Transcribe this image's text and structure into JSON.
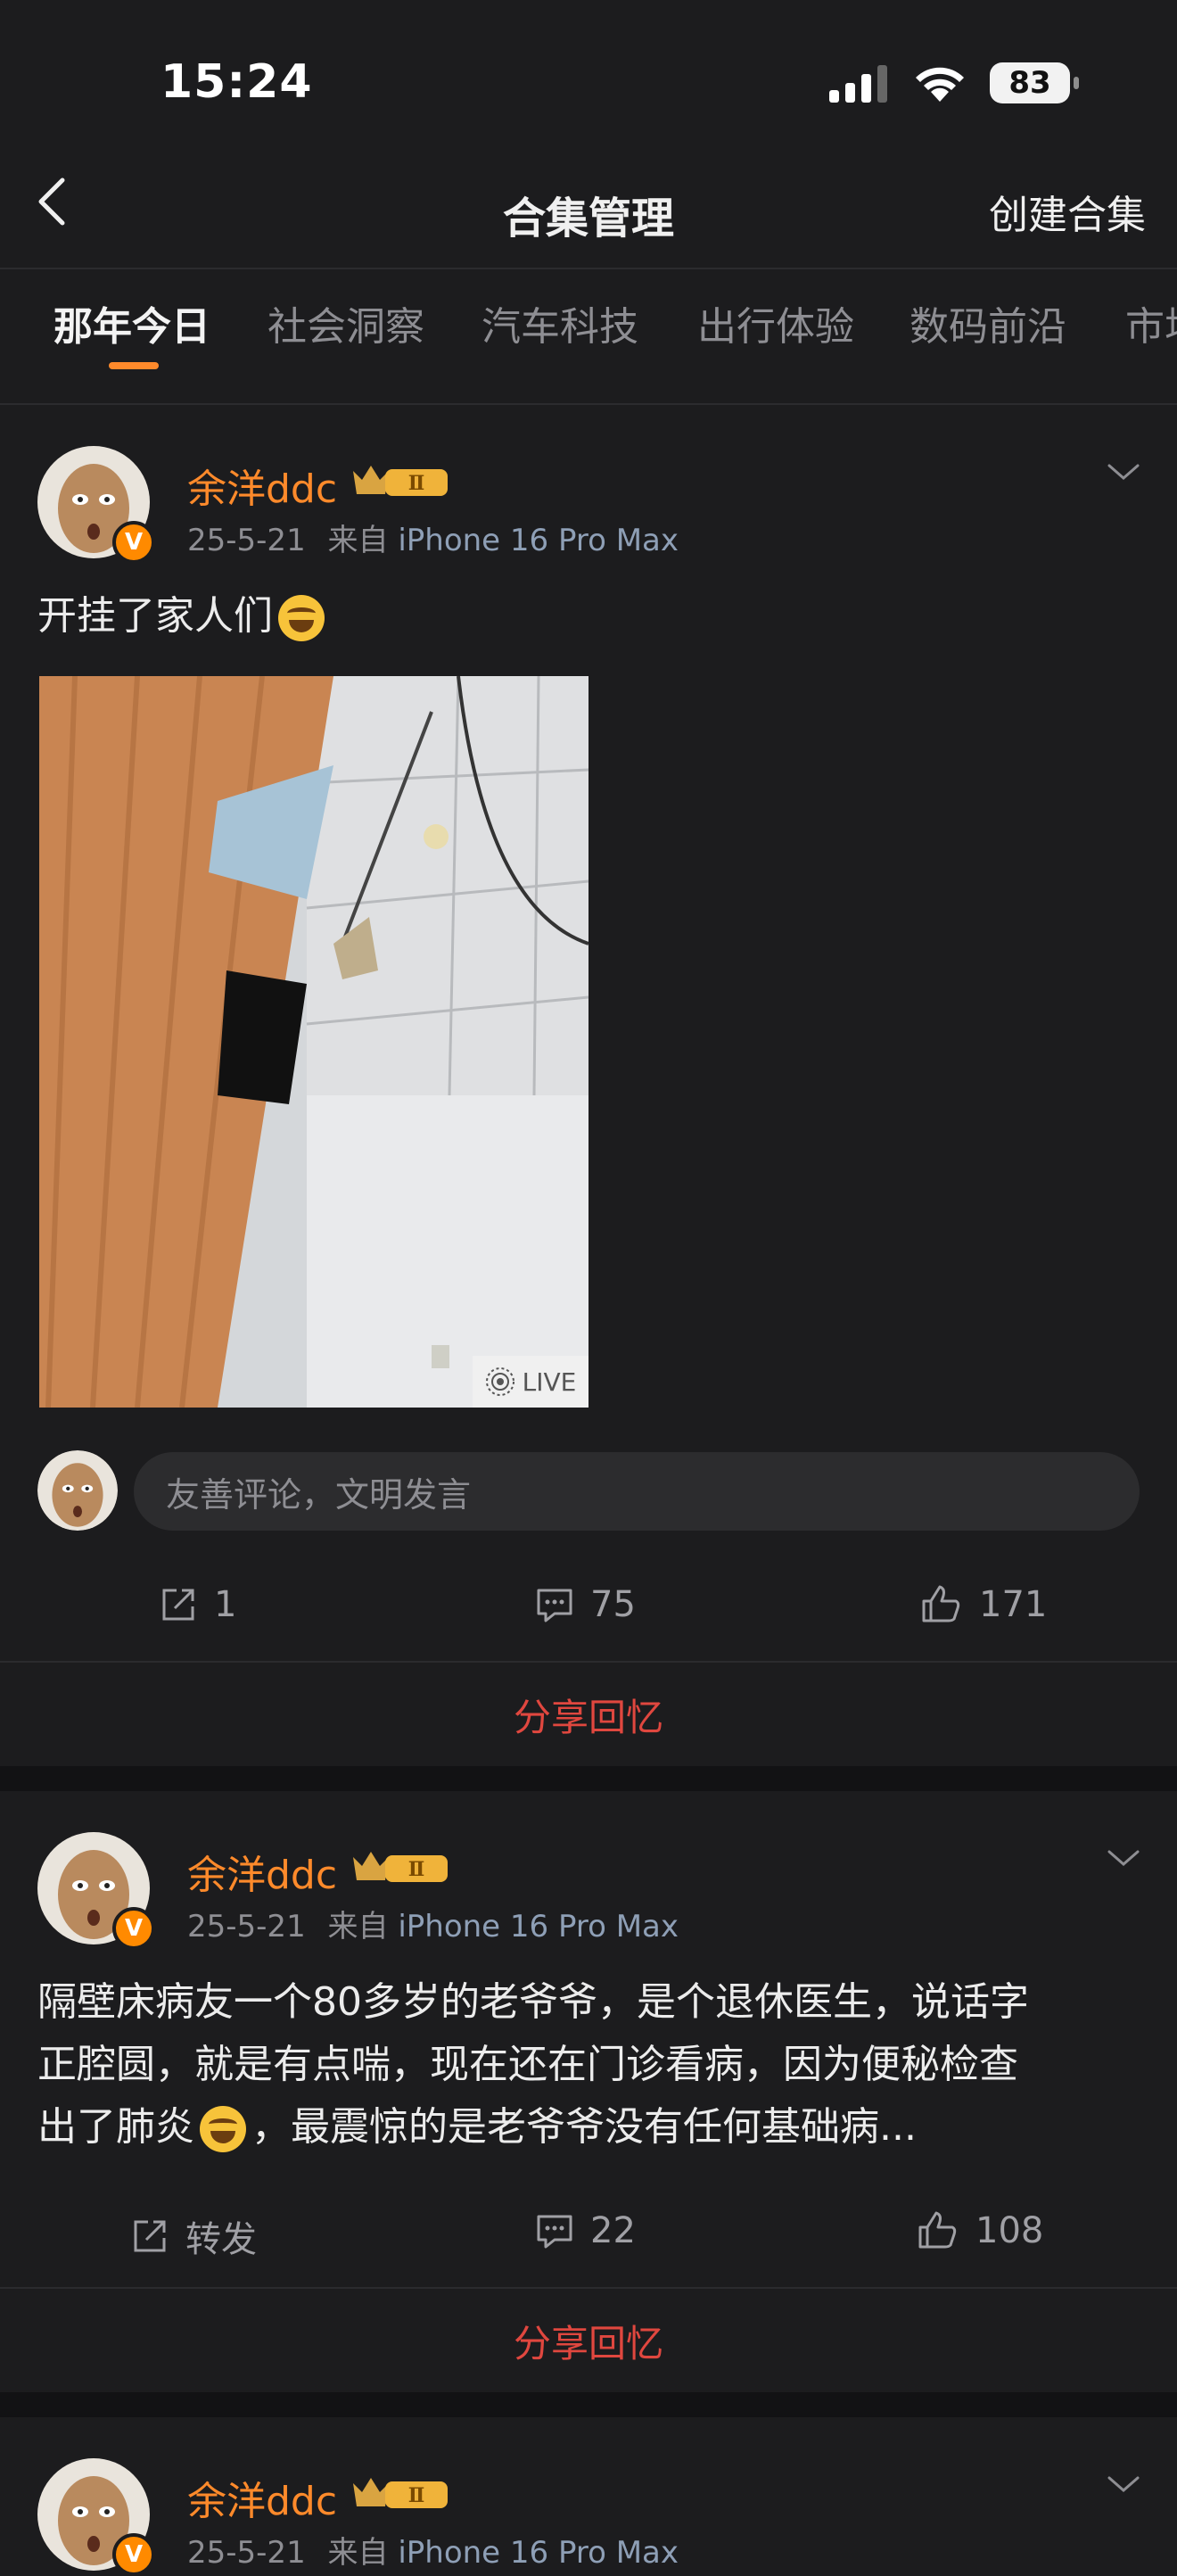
{
  "status": {
    "time": "15:24",
    "battery": "83"
  },
  "nav": {
    "title": "合集管理",
    "create_label": "创建合集"
  },
  "tabs": [
    "那年今日",
    "社会洞察",
    "汽车科技",
    "出行体验",
    "数码前沿",
    "市场"
  ],
  "posts": [
    {
      "username": "余洋ddc",
      "level": "Ⅱ",
      "date": "25-5-21",
      "from": "来自",
      "source": "iPhone 16 Pro Max",
      "text": "开挂了家人们",
      "has_photo": true,
      "photo_badge": "LIVE",
      "comment_placeholder": "友善评论，文明发言",
      "repost": "1",
      "comments": "75",
      "likes": "171",
      "share_memory": "分享回忆"
    },
    {
      "username": "余洋ddc",
      "level": "Ⅱ",
      "date": "25-5-21",
      "from": "来自",
      "source": "iPhone 16 Pro Max",
      "text_line1": "隔壁床病友一个80多岁的老爷爷，是个退休医生，说话字",
      "text_line2": "正腔圆，就是有点喘，现在还在门诊看病，因为便秘检查",
      "text_line3a": "出了肺炎",
      "text_line3b": "，最震惊的是老爷爷没有任何基础病...",
      "repost": "转发",
      "comments": "22",
      "likes": "108",
      "share_memory": "分享回忆"
    },
    {
      "username": "余洋ddc",
      "level": "Ⅱ",
      "date": "25-5-21",
      "from": "来自",
      "source": "iPhone 16 Pro Max"
    }
  ]
}
